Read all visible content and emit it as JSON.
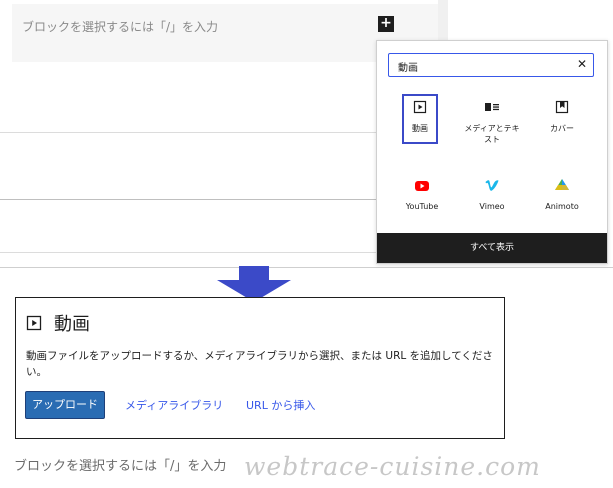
{
  "editor": {
    "placeholder": "ブロックを選択するには「/」を入力",
    "inserter_symbol": "+"
  },
  "inserter": {
    "search_value": "動画",
    "clear_symbol": "✕",
    "blocks": [
      {
        "label": "動画",
        "icon": "video-icon",
        "selected": true
      },
      {
        "label": "メディアとテキスト",
        "icon": "media-text-icon"
      },
      {
        "label": "カバー",
        "icon": "cover-icon"
      },
      {
        "label": "YouTube",
        "icon": "youtube-icon",
        "color": "#ff0000"
      },
      {
        "label": "Vimeo",
        "icon": "vimeo-icon",
        "color": "#1ab7ea"
      },
      {
        "label": "Animoto",
        "icon": "animoto-icon"
      }
    ],
    "show_all": "すべて表示"
  },
  "video_block": {
    "title": "動画",
    "description": "動画ファイルをアップロードするか、メディアライブラリから選択、または URL を追加してください。",
    "upload": "アップロード",
    "media_library": "メディアライブラリ",
    "insert_url": "URL から挿入"
  },
  "below_placeholder": "ブロックを選択するには「/」を入力",
  "watermark": "webtrace-cuisine.com",
  "colors": {
    "accent": "#3858e9",
    "arrow": "#3b4ac8",
    "button": "#2a6cb3"
  }
}
